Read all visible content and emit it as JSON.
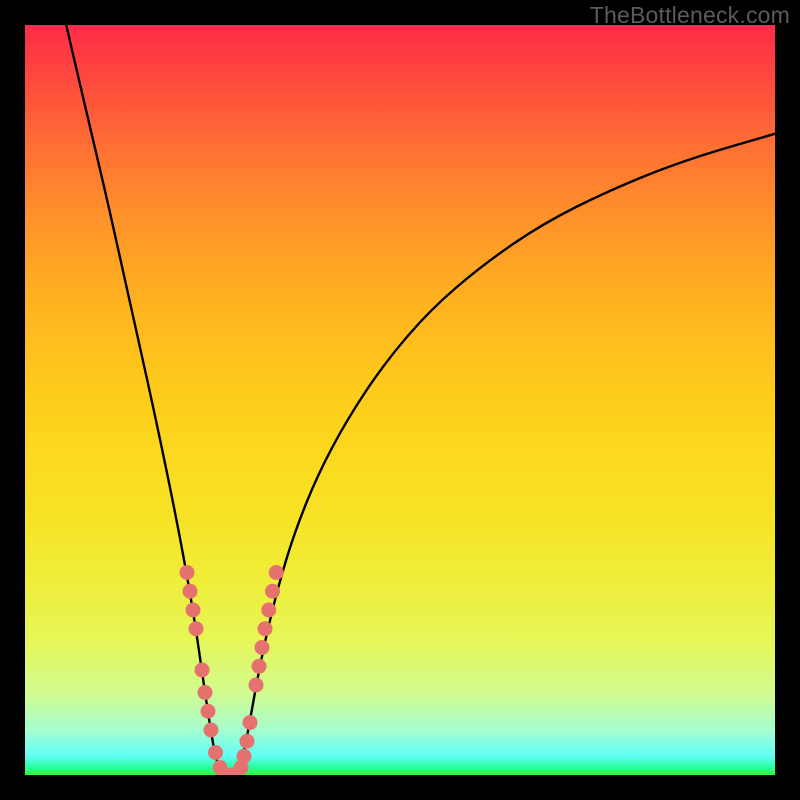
{
  "watermark": "TheBottleneck.com",
  "colors": {
    "frame": "#000000",
    "curve": "#000000",
    "marker": "#e5726f",
    "gradient_top": "#fe2b49",
    "gradient_bottom": "#2bfe2c"
  },
  "chart_data": {
    "type": "line",
    "title": "",
    "xlabel": "",
    "ylabel": "",
    "xlim": [
      0,
      100
    ],
    "ylim": [
      0,
      100
    ],
    "grid": false,
    "curve": [
      {
        "x": 5.5,
        "y": 100.0
      },
      {
        "x": 7.0,
        "y": 93.5
      },
      {
        "x": 9.0,
        "y": 85.0
      },
      {
        "x": 11.0,
        "y": 76.5
      },
      {
        "x": 13.0,
        "y": 67.5
      },
      {
        "x": 15.0,
        "y": 58.5
      },
      {
        "x": 17.0,
        "y": 49.5
      },
      {
        "x": 19.0,
        "y": 40.0
      },
      {
        "x": 20.5,
        "y": 32.5
      },
      {
        "x": 21.7,
        "y": 26.0
      },
      {
        "x": 22.7,
        "y": 20.0
      },
      {
        "x": 23.5,
        "y": 14.5
      },
      {
        "x": 24.3,
        "y": 9.0
      },
      {
        "x": 25.0,
        "y": 4.5
      },
      {
        "x": 25.7,
        "y": 1.2
      },
      {
        "x": 26.7,
        "y": 0.0
      },
      {
        "x": 27.7,
        "y": 0.0
      },
      {
        "x": 28.7,
        "y": 1.2
      },
      {
        "x": 29.5,
        "y": 4.5
      },
      {
        "x": 30.3,
        "y": 9.0
      },
      {
        "x": 31.3,
        "y": 14.5
      },
      {
        "x": 32.5,
        "y": 20.0
      },
      {
        "x": 34.0,
        "y": 26.0
      },
      {
        "x": 36.0,
        "y": 32.5
      },
      {
        "x": 39.0,
        "y": 40.0
      },
      {
        "x": 43.0,
        "y": 47.5
      },
      {
        "x": 48.0,
        "y": 55.0
      },
      {
        "x": 54.0,
        "y": 62.0
      },
      {
        "x": 61.0,
        "y": 68.0
      },
      {
        "x": 69.0,
        "y": 73.5
      },
      {
        "x": 78.0,
        "y": 78.0
      },
      {
        "x": 88.0,
        "y": 82.0
      },
      {
        "x": 100.0,
        "y": 85.5
      }
    ],
    "markers": [
      {
        "x": 21.6,
        "y": 27.0
      },
      {
        "x": 22.0,
        "y": 24.5
      },
      {
        "x": 22.4,
        "y": 22.0
      },
      {
        "x": 22.8,
        "y": 19.5
      },
      {
        "x": 23.6,
        "y": 14.0
      },
      {
        "x": 24.0,
        "y": 11.0
      },
      {
        "x": 24.4,
        "y": 8.5
      },
      {
        "x": 24.8,
        "y": 6.0
      },
      {
        "x": 25.4,
        "y": 3.0
      },
      {
        "x": 26.0,
        "y": 1.0
      },
      {
        "x": 26.7,
        "y": 0.0
      },
      {
        "x": 27.4,
        "y": 0.0
      },
      {
        "x": 28.1,
        "y": 0.0
      },
      {
        "x": 28.8,
        "y": 1.0
      },
      {
        "x": 29.2,
        "y": 2.5
      },
      {
        "x": 29.6,
        "y": 4.5
      },
      {
        "x": 30.0,
        "y": 7.0
      },
      {
        "x": 30.8,
        "y": 12.0
      },
      {
        "x": 31.2,
        "y": 14.5
      },
      {
        "x": 31.6,
        "y": 17.0
      },
      {
        "x": 32.0,
        "y": 19.5
      },
      {
        "x": 32.5,
        "y": 22.0
      },
      {
        "x": 33.0,
        "y": 24.5
      },
      {
        "x": 33.5,
        "y": 27.0
      }
    ]
  }
}
